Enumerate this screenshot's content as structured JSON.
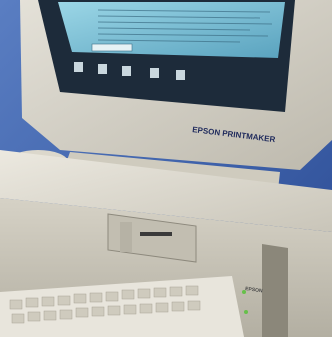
{
  "photo": {
    "monitor_brand": "EPSON",
    "monitor_model": "EPSON PRINTMAKER",
    "tower_brand": "EPSON",
    "colors": {
      "backdrop": "#3c5fa8",
      "backdrop_dark": "#2b4a90",
      "beige": "#d8d4c8",
      "beige_shadow": "#a8a496",
      "screen_window": "#7fc4d8",
      "screen_frame": "#1d2b3a",
      "led_green": "#66c04a"
    }
  }
}
